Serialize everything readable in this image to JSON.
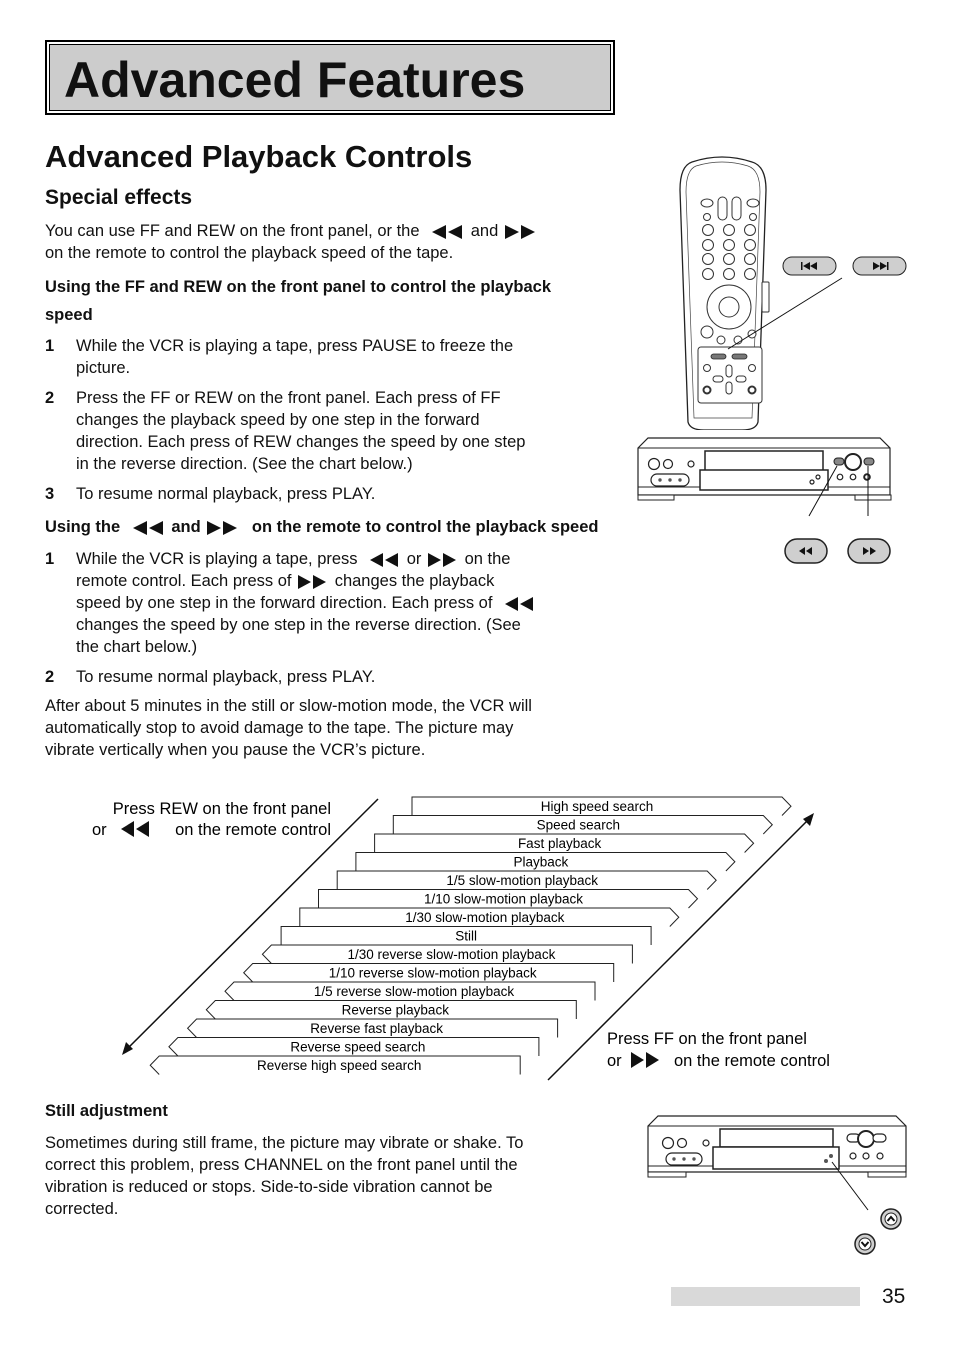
{
  "page": {
    "banner_title": "Advanced Features",
    "section_title": "Advanced Playback Controls",
    "subsection_title": "Special effects",
    "page_number": "35"
  },
  "intro": {
    "line1_a": "You can use FF and REW on the front panel, or the",
    "and": "and",
    "line2": "on the remote to control the playback speed of the tape."
  },
  "front_panel_method": {
    "heading_line1": "Using the FF and REW on the front panel to control the playback",
    "heading_line2": "speed",
    "steps": [
      {
        "num": "1",
        "lines": [
          "While the VCR is playing a tape, press PAUSE to freeze the",
          "picture."
        ]
      },
      {
        "num": "2",
        "lines": [
          "Press the FF or REW on the front panel.  Each press of FF",
          "changes the playback speed by one step in the forward",
          "direction.  Each press of REW changes the speed by one step",
          "in the reverse direction.  (See the chart below.)"
        ]
      },
      {
        "num": "3",
        "lines": [
          "To resume normal playback, press PLAY."
        ]
      }
    ]
  },
  "remote_method": {
    "heading_a": "Using the",
    "heading_and": "and",
    "heading_b": "on the remote to control the playback speed",
    "step1": {
      "num": "1",
      "l1_a": "While the VCR is playing a tape, press",
      "l1_or": "or",
      "l1_b": "on the",
      "l2_a": "remote control.  Each press of",
      "l2_b": "changes the playback",
      "l3": "speed by one step in the forward direction.  Each press of",
      "l4": "changes the speed by one step in the reverse direction.  (See",
      "l5": "the chart below.)"
    },
    "step2": {
      "num": "2",
      "text": "To resume normal playback, press PLAY."
    }
  },
  "note": {
    "lines": [
      "After about 5 minutes in the still or slow-motion mode, the VCR will",
      "automatically stop to avoid damage to the tape.  The picture may",
      "vibrate vertically when you pause the VCR’s picture."
    ]
  },
  "speed_chart": {
    "rew_label_line1": "Press REW on the front panel",
    "rew_label_or": "or",
    "rew_label_line2": "on the remote control",
    "ff_label_line1": "Press FF on the front panel",
    "ff_label_or": "or",
    "ff_label_line2": "on the remote control",
    "forward_steps": [
      "High speed search",
      "Speed search",
      "Fast playback",
      "Playback",
      "1/5 slow-motion playback",
      "1/10 slow-motion playback",
      "1/30 slow-motion playback"
    ],
    "still": "Still",
    "reverse_steps": [
      "1/30 reverse slow-motion playback",
      "1/10 reverse slow-motion playback",
      "1/5 reverse slow-motion playback",
      "Reverse playback",
      "Reverse fast playback",
      "Reverse speed search",
      "Reverse high speed search"
    ]
  },
  "still_adjustment": {
    "heading": "Still adjustment",
    "lines": [
      "Sometimes during still frame, the picture may vibrate or shake.  To",
      "correct this problem, press CHANNEL on the front panel until the",
      "vibration is reduced or stops.  Side-to-side vibration cannot be",
      "corrected."
    ]
  },
  "illustrations": {
    "remote_buttons": [
      "skip-back-icon",
      "skip-forward-icon"
    ],
    "vcr_buttons": [
      "rewind-icon",
      "fast-forward-icon"
    ],
    "channel_buttons": [
      "channel-up-icon",
      "channel-down-icon"
    ]
  }
}
